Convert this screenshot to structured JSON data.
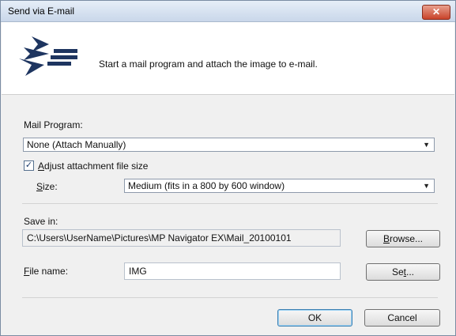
{
  "window": {
    "title": "Send via E-mail",
    "close_glyph": "✕"
  },
  "header": {
    "icon": "send-mail-icon",
    "description": "Start a mail program and attach the image to e-mail."
  },
  "mail_program": {
    "label": "Mail Program:",
    "selected": "None (Attach Manually)"
  },
  "adjust_size": {
    "checked": true,
    "check_glyph": "✓",
    "label_first": "A",
    "label_rest": "djust attachment file size"
  },
  "size": {
    "label_first": "S",
    "label_rest": "ize:",
    "selected": "Medium (fits in a 800 by 600 window)"
  },
  "save_in": {
    "label": "Save in:",
    "path": "C:\\Users\\UserName\\Pictures\\MP Navigator EX\\Mail_20100101",
    "browse_first": "B",
    "browse_rest": "rowse..."
  },
  "file_name": {
    "label_first": "F",
    "label_rest": "ile name:",
    "value": "IMG",
    "set_before": "Se",
    "set_underline": "t",
    "set_after": "..."
  },
  "footer": {
    "ok_label": "OK",
    "cancel_label": "Cancel"
  },
  "colors": {
    "title_bar": "#c9d7ea",
    "close_button": "#c9432a",
    "default_button_border": "#3c7fb1",
    "icon_navy": "#1e3560"
  }
}
